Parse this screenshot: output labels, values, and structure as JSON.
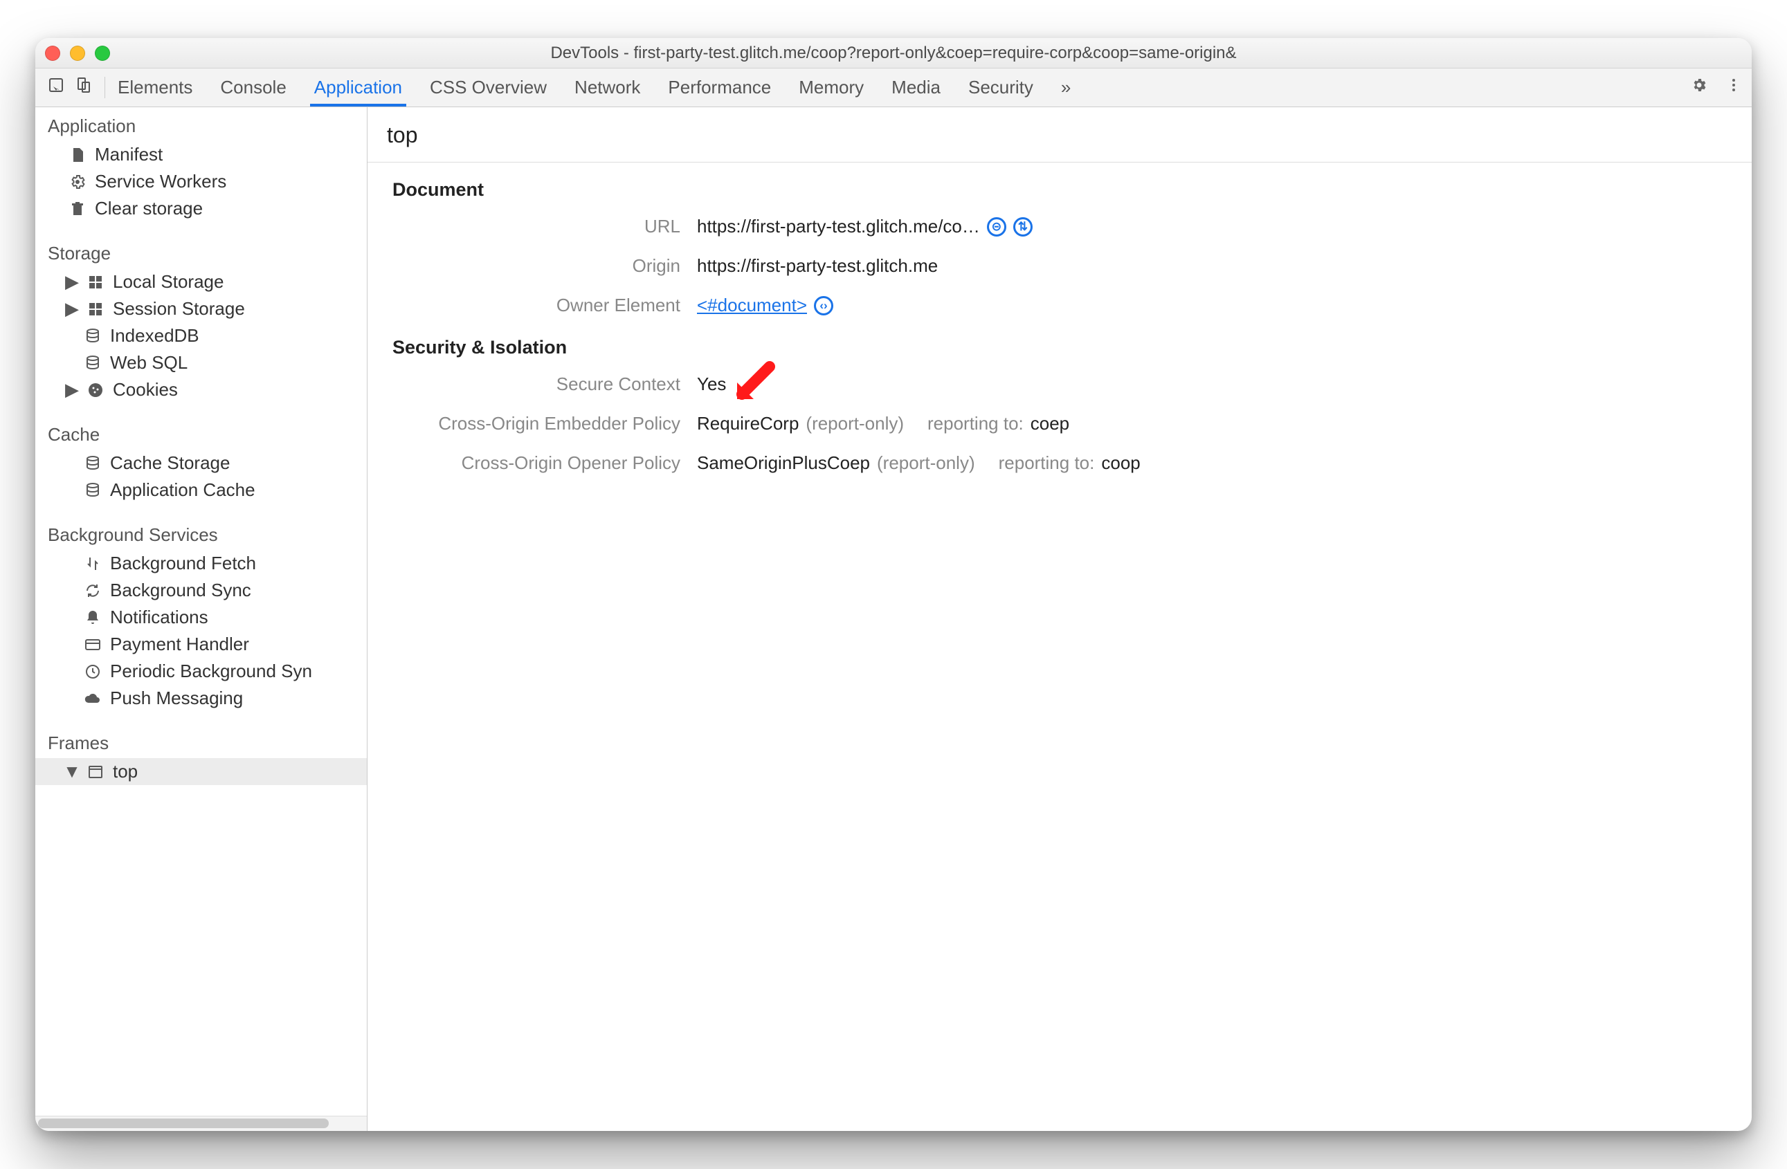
{
  "window": {
    "title": "DevTools - first-party-test.glitch.me/coop?report-only&coep=require-corp&coop=same-origin&"
  },
  "toolbar": {
    "tabs": [
      "Elements",
      "Console",
      "Application",
      "CSS Overview",
      "Network",
      "Performance",
      "Memory",
      "Media",
      "Security"
    ],
    "active": "Application",
    "overflow": "»"
  },
  "sidebar": {
    "sections": [
      {
        "title": "Application",
        "items": [
          {
            "icon": "file",
            "label": "Manifest"
          },
          {
            "icon": "gear",
            "label": "Service Workers"
          },
          {
            "icon": "trash",
            "label": "Clear storage"
          }
        ]
      },
      {
        "title": "Storage",
        "items": [
          {
            "icon": "grid",
            "label": "Local Storage",
            "caret": true
          },
          {
            "icon": "grid",
            "label": "Session Storage",
            "caret": true
          },
          {
            "icon": "db",
            "label": "IndexedDB"
          },
          {
            "icon": "db",
            "label": "Web SQL"
          },
          {
            "icon": "cookie",
            "label": "Cookies",
            "caret": true
          }
        ]
      },
      {
        "title": "Cache",
        "items": [
          {
            "icon": "db",
            "label": "Cache Storage"
          },
          {
            "icon": "db",
            "label": "Application Cache"
          }
        ]
      },
      {
        "title": "Background Services",
        "items": [
          {
            "icon": "updown",
            "label": "Background Fetch"
          },
          {
            "icon": "sync",
            "label": "Background Sync"
          },
          {
            "icon": "bell",
            "label": "Notifications"
          },
          {
            "icon": "card",
            "label": "Payment Handler"
          },
          {
            "icon": "clock",
            "label": "Periodic Background Syn"
          },
          {
            "icon": "cloud",
            "label": "Push Messaging"
          }
        ]
      },
      {
        "title": "Frames",
        "items": [
          {
            "icon": "window",
            "label": "top",
            "caret": true,
            "caretOpen": true,
            "selected": true
          }
        ]
      }
    ]
  },
  "content": {
    "title": "top",
    "document": {
      "heading": "Document",
      "url_label": "URL",
      "url_value": "https://first-party-test.glitch.me/co…",
      "origin_label": "Origin",
      "origin_value": "https://first-party-test.glitch.me",
      "owner_label": "Owner Element",
      "owner_link": "<#document>"
    },
    "security": {
      "heading": "Security & Isolation",
      "secure_label": "Secure Context",
      "secure_value": "Yes",
      "coep_label": "Cross-Origin Embedder Policy",
      "coep_value": "RequireCorp",
      "coep_mode": "(report-only)",
      "coep_reporting_label": "reporting to:",
      "coep_reporting_value": "coep",
      "coop_label": "Cross-Origin Opener Policy",
      "coop_value": "SameOriginPlusCoep",
      "coop_mode": "(report-only)",
      "coop_reporting_label": "reporting to:",
      "coop_reporting_value": "coop"
    }
  }
}
